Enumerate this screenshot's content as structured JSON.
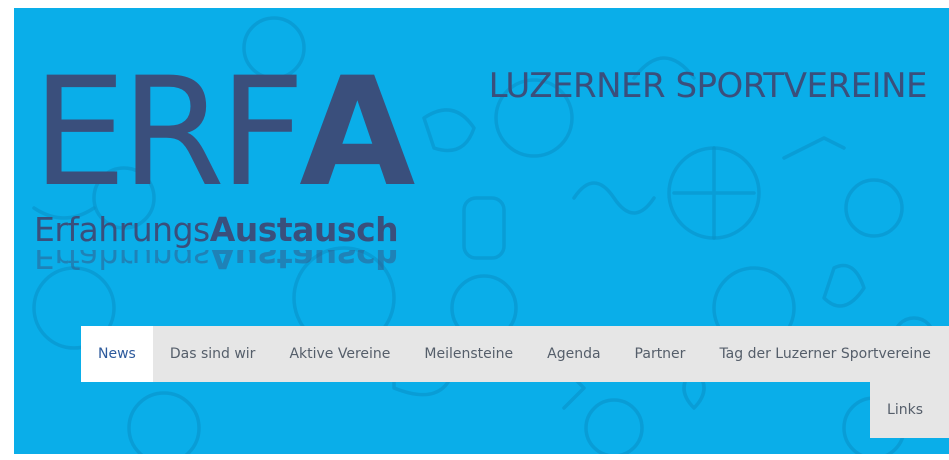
{
  "header": {
    "logo": {
      "big_regular": "ERF",
      "big_bold": "A",
      "sub_regular": "Erfahrungs",
      "sub_bold": "Austausch"
    },
    "tagline": "LUZERNER SPORTVEREINE"
  },
  "nav": {
    "items": [
      {
        "label": "News",
        "active": true
      },
      {
        "label": "Das sind wir"
      },
      {
        "label": "Aktive Vereine"
      },
      {
        "label": "Meilensteine"
      },
      {
        "label": "Agenda"
      },
      {
        "label": "Partner"
      },
      {
        "label": "Tag der Luzerner Sportvereine"
      },
      {
        "label": "Links"
      }
    ]
  },
  "colors": {
    "banner_bg": "#0aaee9",
    "logo_text": "#3a4f7c",
    "nav_bg": "#e6e6e6",
    "nav_active_text": "#2d5a9c"
  },
  "icons": [
    "sports-pattern-background"
  ]
}
